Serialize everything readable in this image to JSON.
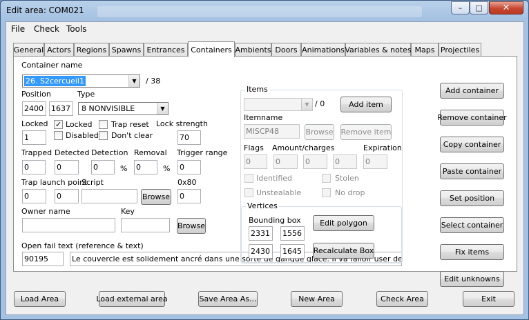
{
  "window": {
    "title": "Edit area: COM021"
  },
  "window_controls": {
    "minimize": "–",
    "maximize": "□",
    "close": "✕"
  },
  "menu": [
    "File",
    "Check",
    "Tools"
  ],
  "tabs": [
    "General",
    "Actors",
    "Regions",
    "Spawns",
    "Entrances",
    "Containers",
    "Ambients",
    "Doors",
    "Animations",
    "Variables & notes",
    "Maps",
    "Projectiles"
  ],
  "active_tab": "Containers",
  "container": {
    "name_label": "Container name",
    "name_value": "26. S2cercueil1",
    "count": "/ 38",
    "position_label": "Position",
    "pos_x": "2400",
    "pos_y": "1637",
    "type_label": "Type",
    "type_value": "8 NONVISIBLE",
    "locked_label": "Locked",
    "locked_value": "1",
    "chk_locked": "Locked",
    "chk_trap_reset": "Trap reset",
    "chk_disabled": "Disabled",
    "chk_dont_clear": "Don't clear",
    "lock_strength_label": "Lock strength",
    "lock_strength": "70",
    "trapped_label": "Trapped",
    "trapped": "0",
    "detected_label": "Detected",
    "detected": "0",
    "detection_label": "Detection",
    "detection": "0",
    "removal_label": "Removal",
    "removal": "0",
    "percent": "%",
    "trigger_range_label": "Trigger range",
    "trigger_range": "0",
    "trap_launch_label": "Trap launch point",
    "trap_x": "0",
    "trap_y": "0",
    "script_label": "Script",
    "script": "",
    "browse": "Browse",
    "hex_label": "0x80",
    "hex_value": "0",
    "owner_label": "Owner name",
    "owner": "",
    "key_label": "Key",
    "key": "",
    "open_fail_label": "Open fail text (reference & text)",
    "open_fail_ref": "90195",
    "open_fail_text": "Le couvercle est solidement ancré dans une sorte de gangue glace. Il va falloir user de la force."
  },
  "items": {
    "group_label": "Items",
    "count": "/ 0",
    "add_item": "Add item",
    "itemname_label": "Itemname",
    "itemname": "MISCP48",
    "browse": "Browse",
    "remove_item": "Remove item",
    "flags_label": "Flags",
    "amount_label": "Amount/charges",
    "expiration_label": "Expiration",
    "flags": "0",
    "amount1": "0",
    "amount2": "0",
    "amount3": "0",
    "expiration": "0",
    "identified": "Identified",
    "stolen": "Stolen",
    "unstealable": "Unstealable",
    "no_drop": "No drop"
  },
  "vertices": {
    "group_label": "Vertices",
    "bbox_label": "Bounding box",
    "x1": "2331",
    "y1": "1556",
    "x2": "2430",
    "y2": "1645",
    "edit_polygon": "Edit polygon",
    "recalc": "Recalculate Box"
  },
  "side_buttons": [
    "Add container",
    "Remove container",
    "Copy container",
    "Paste container",
    "Set position",
    "Select container",
    "Fix items",
    "Edit unknowns"
  ],
  "footer_buttons": [
    "Load Area",
    "Load external area",
    "Save Area As...",
    "New Area",
    "Check Area",
    "Exit"
  ]
}
